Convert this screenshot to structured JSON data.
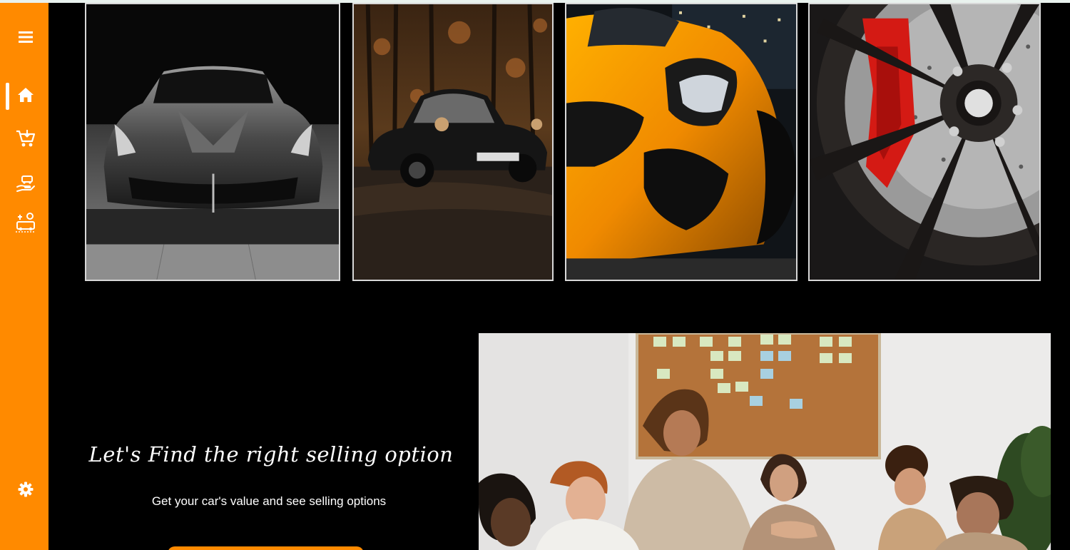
{
  "sidebar": {
    "items": [
      {
        "name": "menu",
        "icon": "hamburger-menu-icon"
      },
      {
        "name": "home",
        "icon": "home-icon",
        "active": true
      },
      {
        "name": "shop",
        "icon": "shopping-cart-icon"
      },
      {
        "name": "sell",
        "icon": "hand-car-icon"
      },
      {
        "name": "services",
        "icon": "car-service-icon"
      },
      {
        "name": "settings",
        "icon": "gear-icon"
      }
    ],
    "accent": "#ff8a00"
  },
  "gallery": {
    "tiles": [
      {
        "subject": "black-white-supercar"
      },
      {
        "subject": "vintage-porsche-forest"
      },
      {
        "subject": "orange-sports-car"
      },
      {
        "subject": "wheel-red-caliper"
      }
    ]
  },
  "hero": {
    "headline": "Let's Find the right selling option",
    "subheadline": "Get your car's value and see selling options"
  },
  "colors": {
    "background": "#000000",
    "accent": "#ff8a00",
    "text": "#ffffff"
  }
}
